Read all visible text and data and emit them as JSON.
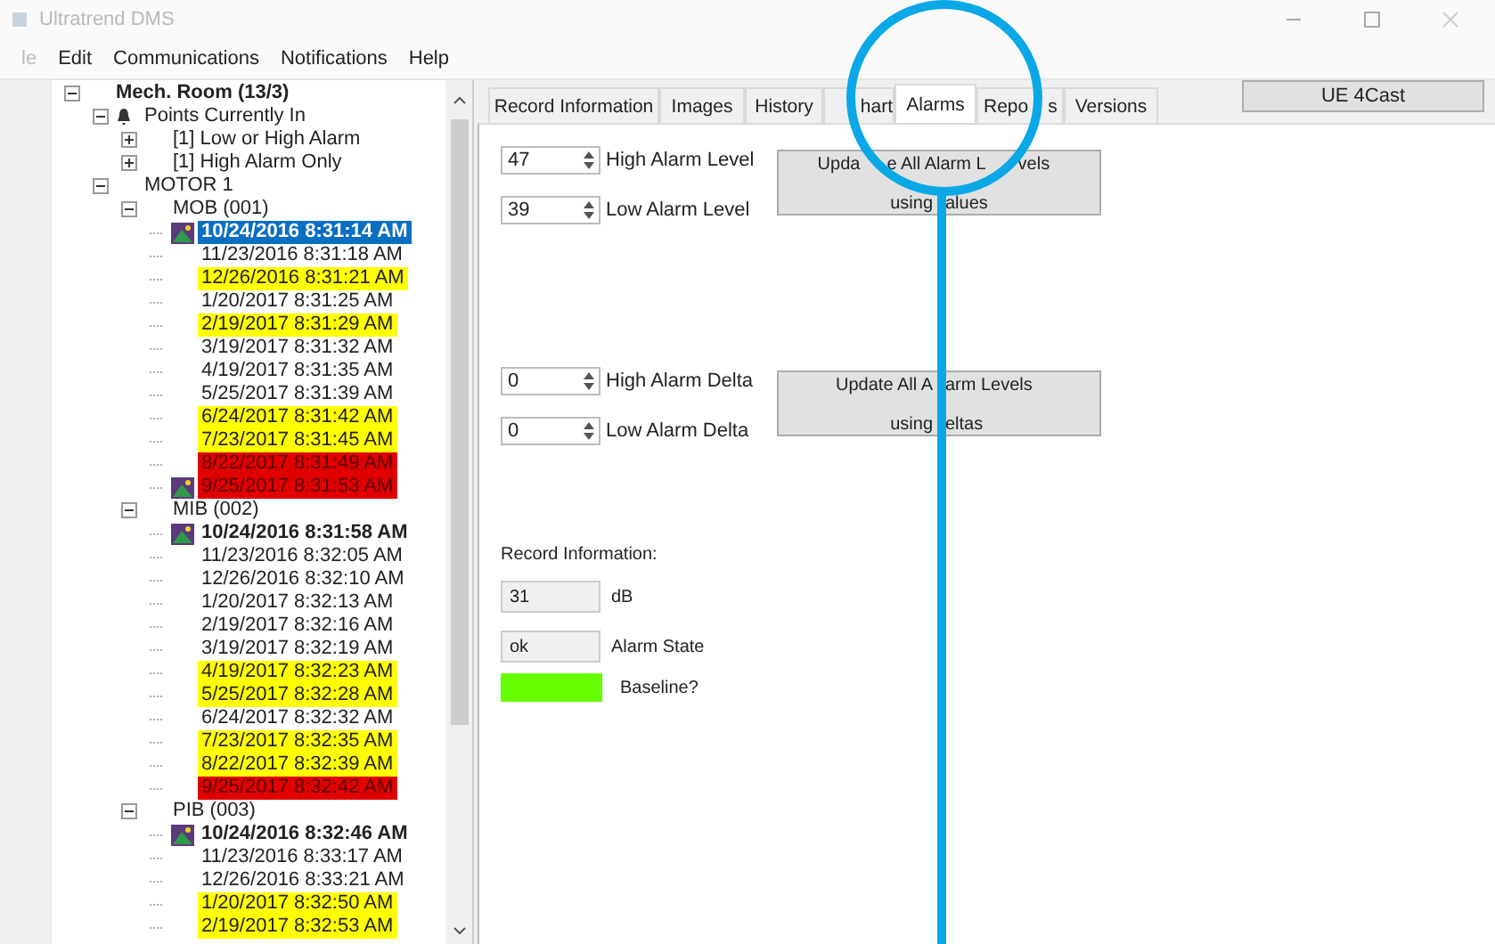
{
  "window": {
    "title": "Ultratrend DMS"
  },
  "menu": [
    "le",
    "Edit",
    "Communications",
    "Notifications",
    "Help"
  ],
  "tree": [
    {
      "label": "Mech. Room (13/3)",
      "bold": true,
      "expanded": true,
      "selected": false,
      "children": [
        {
          "label": "Points Currently In",
          "kind": "alerts",
          "expanded": true,
          "selected": false,
          "children": [
            {
              "label": "[1] Low or High Alarm",
              "expanded": false,
              "selected": false
            },
            {
              "label": "[1] High Alarm Only",
              "expanded": false,
              "selected": false
            }
          ]
        },
        {
          "label": "MOTOR 1",
          "expanded": true,
          "selected": false,
          "children": [
            {
              "label": "MOB (001)",
              "expanded": true,
              "selected": false,
              "children": [
                {
                  "label": "10/24/2016 8:31:14 AM",
                  "kind": "imaged",
                  "bold": true,
                  "selected": true
                },
                {
                  "label": "11/23/2016 8:31:18 AM",
                  "selected": false
                },
                {
                  "label": "12/26/2016 8:31:21 AM",
                  "color": "#ffff00",
                  "selected": false
                },
                {
                  "label": "1/20/2017 8:31:25 AM",
                  "selected": false
                },
                {
                  "label": "2/19/2017 8:31:29 AM",
                  "color": "#ffff00",
                  "selected": false
                },
                {
                  "label": "3/19/2017 8:31:32 AM",
                  "selected": false
                },
                {
                  "label": "4/19/2017 8:31:35 AM",
                  "selected": false
                },
                {
                  "label": "5/25/2017 8:31:39 AM",
                  "selected": false
                },
                {
                  "label": "6/24/2017 8:31:42 AM",
                  "color": "#ffff00",
                  "selected": false
                },
                {
                  "label": "7/23/2017 8:31:45 AM",
                  "color": "#ffff00",
                  "selected": false
                },
                {
                  "label": "8/22/2017 8:31:49 AM",
                  "color": "#e00000",
                  "selected": false
                },
                {
                  "label": "9/25/2017 8:31:53 AM",
                  "kind": "imaged",
                  "color": "#e00000",
                  "selected": false
                }
              ]
            },
            {
              "label": "MIB (002)",
              "expanded": true,
              "selected": false,
              "children": [
                {
                  "label": "10/24/2016 8:31:58 AM",
                  "kind": "imaged",
                  "bold": true,
                  "selected": false
                },
                {
                  "label": "11/23/2016 8:32:05 AM",
                  "selected": false
                },
                {
                  "label": "12/26/2016 8:32:10 AM",
                  "selected": false
                },
                {
                  "label": "1/20/2017 8:32:13 AM",
                  "selected": false
                },
                {
                  "label": "2/19/2017 8:32:16 AM",
                  "selected": false
                },
                {
                  "label": "3/19/2017 8:32:19 AM",
                  "selected": false
                },
                {
                  "label": "4/19/2017 8:32:23 AM",
                  "color": "#ffff00",
                  "selected": false
                },
                {
                  "label": "5/25/2017 8:32:28 AM",
                  "color": "#ffff00",
                  "selected": false
                },
                {
                  "label": "6/24/2017 8:32:32 AM",
                  "selected": false
                },
                {
                  "label": "7/23/2017 8:32:35 AM",
                  "color": "#ffff00",
                  "selected": false
                },
                {
                  "label": "8/22/2017 8:32:39 AM",
                  "color": "#ffff00",
                  "selected": false
                },
                {
                  "label": "9/25/2017 8:32:42 AM",
                  "color": "#e00000",
                  "selected": false
                }
              ]
            },
            {
              "label": "PIB (003)",
              "expanded": true,
              "selected": false,
              "children": [
                {
                  "label": "10/24/2016 8:32:46 AM",
                  "kind": "imaged",
                  "bold": true,
                  "selected": false
                },
                {
                  "label": "11/23/2016 8:33:17 AM",
                  "selected": false
                },
                {
                  "label": "12/26/2016 8:33:21 AM",
                  "selected": false
                },
                {
                  "label": "1/20/2017 8:32:50 AM",
                  "color": "#ffff00",
                  "selected": false
                },
                {
                  "label": "2/19/2017 8:32:53 AM",
                  "color": "#ffff00",
                  "selected": false
                }
              ]
            }
          ]
        }
      ]
    }
  ],
  "tabs": [
    {
      "parts": [
        "Record Information"
      ],
      "selected": false
    },
    {
      "parts": [
        "Images"
      ],
      "selected": false
    },
    {
      "parts": [
        "History"
      ],
      "selected": false
    },
    {
      "parts": [
        "hart"
      ],
      "selected": false
    },
    {
      "parts": [
        "Alarms"
      ],
      "selected": true
    },
    {
      "parts": [
        "Repo",
        "s"
      ],
      "selected": false
    },
    {
      "parts": [
        "Versions"
      ],
      "selected": false
    }
  ],
  "side_button": "UE 4Cast",
  "levels": [
    {
      "value": "47",
      "label": "High Alarm Level"
    },
    {
      "value": "39",
      "label": "Low Alarm Level"
    }
  ],
  "levels_button": [
    [
      "Upda",
      "e All Alarm L",
      "vels"
    ],
    [
      "using",
      "alues"
    ]
  ],
  "deltas": [
    {
      "value": "0",
      "label": "High Alarm Delta"
    },
    {
      "value": "0",
      "label": "Low Alarm Delta"
    }
  ],
  "deltas_button": [
    [
      "Update All A",
      "arm Levels"
    ],
    [
      "using",
      "eltas"
    ]
  ],
  "record": {
    "heading": "Record Information:",
    "fields": [
      {
        "value": "31",
        "label": "dB"
      },
      {
        "value": "ok",
        "label": "Alarm State"
      }
    ],
    "baseline": {
      "label": "Baseline?",
      "color": "#66ff00"
    }
  }
}
